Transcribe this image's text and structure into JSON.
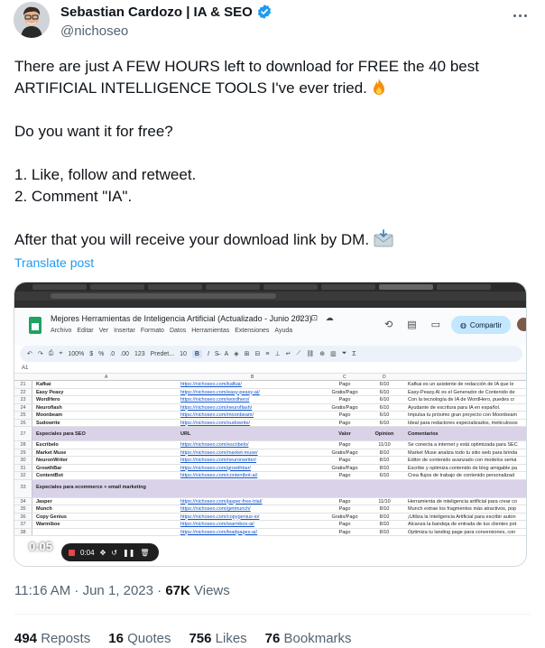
{
  "author": {
    "name": "Sebastian Cardozo | IA & SEO",
    "handle": "@nichoseo"
  },
  "tweet": {
    "line1": "There are just A FEW HOURS left to download for FREE the 40 best",
    "line2": "ARTIFICIAL INTELLIGENCE TOOLS I've ever tried.",
    "line3": "Do you want it for free?",
    "line4": "1. Like, follow and retweet.",
    "line5": "2. Comment \"IA\".",
    "line6": "After that you will receive your download link by DM.",
    "translate": "Translate post"
  },
  "media": {
    "doc_title": "Mejores Herramientas de Inteligencia Artificial (Actualizado - Junio 2023)",
    "doc_icons": "☆ ⊡ ☁",
    "menu": [
      "Archivo",
      "Editar",
      "Ver",
      "Insertar",
      "Formato",
      "Datos",
      "Herramientas",
      "Extensiones",
      "Ayuda"
    ],
    "share_label": "Compartir",
    "toolbar": {
      "zoom": "100%",
      "currency": "$",
      "percent": "%",
      "decimals": ".0",
      "decimals_more": ".00",
      "format_123": "123",
      "font": "Predet...",
      "font_size": "10",
      "bold": "B",
      "italic": "I"
    },
    "cell_ref": "A1",
    "col_headers": [
      "A",
      "B",
      "C",
      "D"
    ],
    "rows": [
      {
        "n": "21",
        "a": "Kafkai",
        "b": "https://nichoseo.com/kafkai/",
        "c": "Pago",
        "d": "6/10",
        "e": "Kafkai es un asistente de redacción de IA que le"
      },
      {
        "n": "22",
        "a": "Easy Peasy",
        "b": "https://nichoseo.com/easy-peasy-ai/",
        "c": "Gratis/Pago",
        "d": "6/10",
        "e": "Easy-Peasy.AI es el Generador de Contenido de"
      },
      {
        "n": "23",
        "a": "WordHero",
        "b": "https://nichoseo.com/wordhero/",
        "c": "Pago",
        "d": "6/10",
        "e": "Con la tecnología de IA de WordHero, puedes cr"
      },
      {
        "n": "24",
        "a": "Neuroflash",
        "b": "https://nichoseo.com/neuroflash/",
        "c": "Gratis/Pago",
        "d": "6/10",
        "e": "Ayudante de escritura para IA en español."
      },
      {
        "n": "25",
        "a": "Moonbeam",
        "b": "https://nichoseo.com/moonbeam/",
        "c": "Pago",
        "d": "6/10",
        "e": "Impulsa tu próximo gran proyecto con Moonbeam"
      },
      {
        "n": "26",
        "a": "Sudowrite",
        "b": "https://nichoseo.com/sudowrite/",
        "c": "Pago",
        "d": "6/10",
        "e": "Ideal para redactores especializados, meticulosos"
      }
    ],
    "section1": {
      "n": "27",
      "a": "Especiales para SEO",
      "b": "URL",
      "c": "Valor",
      "d": "Opinion",
      "e": "Comentarios"
    },
    "rows2": [
      {
        "n": "28",
        "a": "Escribelo",
        "b": "https://nichoseo.com/escribelo/",
        "c": "Pago",
        "d": "11/10",
        "e": "Se conecta a internet y está optimizada para SEC"
      },
      {
        "n": "29",
        "a": "Market Muse",
        "b": "https://nichoseo.com/market-muse/",
        "c": "Gratis/Pago",
        "d": "8/10",
        "e": "Market Muse analiza todo tu sitio web para brinda"
      },
      {
        "n": "30",
        "a": "NeuronWriter",
        "b": "https://nichoseo.com/neuronwriter/",
        "c": "Pago",
        "d": "8/10",
        "e": "Editor de contenido avanzado con modelos semá"
      },
      {
        "n": "31",
        "a": "GrowthBar",
        "b": "https://nichoseo.com/growthbar/",
        "c": "Gratis/Pago",
        "d": "8/10",
        "e": "Escribe y optimiza contenido de blog amigable pa"
      },
      {
        "n": "32",
        "a": "ContentBot",
        "b": "https://nichoseo.com/contentbot-ai/",
        "c": "Pago",
        "d": "6/10",
        "e": "Crea flujos de trabajo de contenido personalizad"
      }
    ],
    "section2": {
      "n": "33",
      "a": "Especiales para ecommerce + email marketing"
    },
    "rows3": [
      {
        "n": "34",
        "a": "Jasper",
        "b": "https://nichoseo.com/jasper-free-trial/",
        "c": "Pago",
        "d": "11/10",
        "e": "Herramienta de inteligencia artificial para crear co"
      },
      {
        "n": "35",
        "a": "Munch",
        "b": "https://nichoseo.com/getmunch/",
        "c": "Pago",
        "d": "8/10",
        "e": "Munch extrae los fragmentos más atractivos, pop"
      },
      {
        "n": "36",
        "a": "Copy Genius",
        "b": "https://nichoseo.com/copygenius-io/",
        "c": "Gratis/Pago",
        "d": "8/10",
        "e": "¡Utiliza la Inteligencia Artificial para escribir auton"
      },
      {
        "n": "37",
        "a": "Warmiboe",
        "b": "https://nichoseo.com/warmbox-ai/",
        "c": "Pago",
        "d": "8/10",
        "e": "Alcanza la bandeja de entrada de tus clientes pot"
      },
      {
        "n": "38",
        "a": "",
        "b": "https://nichoseo.com/leadpages-ai/",
        "c": "Pago",
        "d": "8/10",
        "e": "Optimiza tu landing page para conversiones, con"
      }
    ],
    "video_time": "0:05",
    "rec_time": "0:04"
  },
  "meta": {
    "time": "11:16 AM · Jun 1, 2023 · ",
    "views_count": "67K",
    "views_label": " Views"
  },
  "stats": {
    "reposts_count": "494",
    "reposts_label": " Reposts",
    "quotes_count": "16",
    "quotes_label": " Quotes",
    "likes_count": "756",
    "likes_label": " Likes",
    "bookmarks_count": "76",
    "bookmarks_label": " Bookmarks"
  },
  "colors": {
    "link": "#1d9bf0",
    "verified": "#1d9bf0",
    "muted": "#536471",
    "sheets_green": "#1ea362",
    "section_purple": "#d9d2e9"
  }
}
